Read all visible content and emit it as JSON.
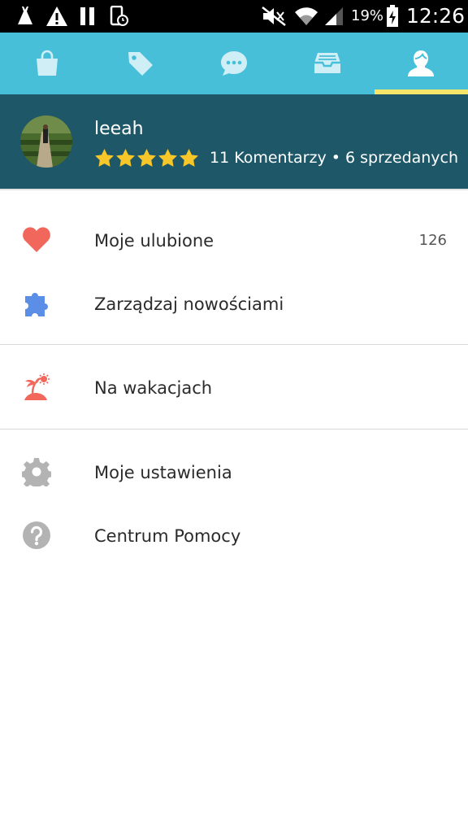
{
  "status_bar": {
    "battery_percent": "19%",
    "time": "12:26"
  },
  "tabs": [
    {
      "icon": "shopping-bag-icon"
    },
    {
      "icon": "tag-icon"
    },
    {
      "icon": "chat-icon"
    },
    {
      "icon": "inbox-icon"
    },
    {
      "icon": "profile-icon",
      "selected": true
    }
  ],
  "profile": {
    "username": "leeah",
    "rating": 5,
    "stats": "11 Komentarzy • 6 sprzedanych"
  },
  "menu": {
    "favorites": {
      "label": "Moje ulubione",
      "count": "126"
    },
    "manage_news": {
      "label": "Zarządzaj nowościami"
    },
    "vacation": {
      "label": "Na wakacjach"
    },
    "settings": {
      "label": "Moje ustawienia"
    },
    "help": {
      "label": "Centrum Pomocy"
    }
  },
  "colors": {
    "tab_bar": "#47bfd9",
    "profile_bg": "#1e5868",
    "tab_indicator": "#f5e66a",
    "star": "#f7c72a",
    "heart": "#f2675c",
    "puzzle": "#5b8ee6",
    "vacation": "#f2675c",
    "gray_icon": "#b3b3b3"
  }
}
